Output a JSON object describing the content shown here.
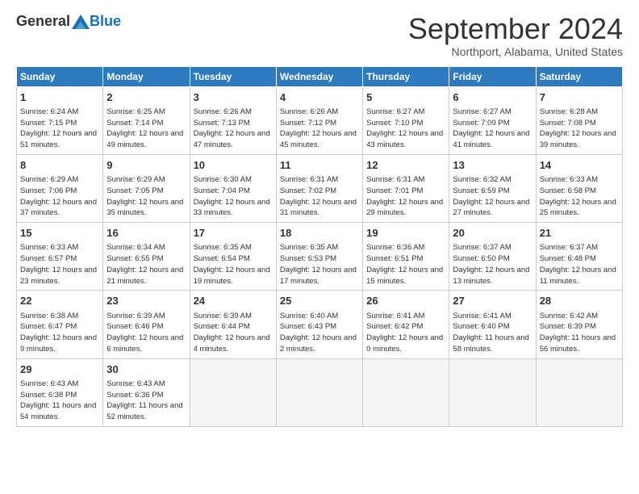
{
  "logo": {
    "general": "General",
    "blue": "Blue"
  },
  "title": "September 2024",
  "subtitle": "Northport, Alabama, United States",
  "days_of_week": [
    "Sunday",
    "Monday",
    "Tuesday",
    "Wednesday",
    "Thursday",
    "Friday",
    "Saturday"
  ],
  "weeks": [
    [
      {
        "day": "1",
        "info": "Sunrise: 6:24 AM\nSunset: 7:15 PM\nDaylight: 12 hours\nand 51 minutes."
      },
      {
        "day": "2",
        "info": "Sunrise: 6:25 AM\nSunset: 7:14 PM\nDaylight: 12 hours\nand 49 minutes."
      },
      {
        "day": "3",
        "info": "Sunrise: 6:26 AM\nSunset: 7:13 PM\nDaylight: 12 hours\nand 47 minutes."
      },
      {
        "day": "4",
        "info": "Sunrise: 6:26 AM\nSunset: 7:12 PM\nDaylight: 12 hours\nand 45 minutes."
      },
      {
        "day": "5",
        "info": "Sunrise: 6:27 AM\nSunset: 7:10 PM\nDaylight: 12 hours\nand 43 minutes."
      },
      {
        "day": "6",
        "info": "Sunrise: 6:27 AM\nSunset: 7:09 PM\nDaylight: 12 hours\nand 41 minutes."
      },
      {
        "day": "7",
        "info": "Sunrise: 6:28 AM\nSunset: 7:08 PM\nDaylight: 12 hours\nand 39 minutes."
      }
    ],
    [
      {
        "day": "8",
        "info": "Sunrise: 6:29 AM\nSunset: 7:06 PM\nDaylight: 12 hours\nand 37 minutes."
      },
      {
        "day": "9",
        "info": "Sunrise: 6:29 AM\nSunset: 7:05 PM\nDaylight: 12 hours\nand 35 minutes."
      },
      {
        "day": "10",
        "info": "Sunrise: 6:30 AM\nSunset: 7:04 PM\nDaylight: 12 hours\nand 33 minutes."
      },
      {
        "day": "11",
        "info": "Sunrise: 6:31 AM\nSunset: 7:02 PM\nDaylight: 12 hours\nand 31 minutes."
      },
      {
        "day": "12",
        "info": "Sunrise: 6:31 AM\nSunset: 7:01 PM\nDaylight: 12 hours\nand 29 minutes."
      },
      {
        "day": "13",
        "info": "Sunrise: 6:32 AM\nSunset: 6:59 PM\nDaylight: 12 hours\nand 27 minutes."
      },
      {
        "day": "14",
        "info": "Sunrise: 6:33 AM\nSunset: 6:58 PM\nDaylight: 12 hours\nand 25 minutes."
      }
    ],
    [
      {
        "day": "15",
        "info": "Sunrise: 6:33 AM\nSunset: 6:57 PM\nDaylight: 12 hours\nand 23 minutes."
      },
      {
        "day": "16",
        "info": "Sunrise: 6:34 AM\nSunset: 6:55 PM\nDaylight: 12 hours\nand 21 minutes."
      },
      {
        "day": "17",
        "info": "Sunrise: 6:35 AM\nSunset: 6:54 PM\nDaylight: 12 hours\nand 19 minutes."
      },
      {
        "day": "18",
        "info": "Sunrise: 6:35 AM\nSunset: 6:53 PM\nDaylight: 12 hours\nand 17 minutes."
      },
      {
        "day": "19",
        "info": "Sunrise: 6:36 AM\nSunset: 6:51 PM\nDaylight: 12 hours\nand 15 minutes."
      },
      {
        "day": "20",
        "info": "Sunrise: 6:37 AM\nSunset: 6:50 PM\nDaylight: 12 hours\nand 13 minutes."
      },
      {
        "day": "21",
        "info": "Sunrise: 6:37 AM\nSunset: 6:48 PM\nDaylight: 12 hours\nand 11 minutes."
      }
    ],
    [
      {
        "day": "22",
        "info": "Sunrise: 6:38 AM\nSunset: 6:47 PM\nDaylight: 12 hours\nand 9 minutes."
      },
      {
        "day": "23",
        "info": "Sunrise: 6:39 AM\nSunset: 6:46 PM\nDaylight: 12 hours\nand 6 minutes."
      },
      {
        "day": "24",
        "info": "Sunrise: 6:39 AM\nSunset: 6:44 PM\nDaylight: 12 hours\nand 4 minutes."
      },
      {
        "day": "25",
        "info": "Sunrise: 6:40 AM\nSunset: 6:43 PM\nDaylight: 12 hours\nand 2 minutes."
      },
      {
        "day": "26",
        "info": "Sunrise: 6:41 AM\nSunset: 6:42 PM\nDaylight: 12 hours\nand 0 minutes."
      },
      {
        "day": "27",
        "info": "Sunrise: 6:41 AM\nSunset: 6:40 PM\nDaylight: 11 hours\nand 58 minutes."
      },
      {
        "day": "28",
        "info": "Sunrise: 6:42 AM\nSunset: 6:39 PM\nDaylight: 11 hours\nand 56 minutes."
      }
    ],
    [
      {
        "day": "29",
        "info": "Sunrise: 6:43 AM\nSunset: 6:38 PM\nDaylight: 11 hours\nand 54 minutes."
      },
      {
        "day": "30",
        "info": "Sunrise: 6:43 AM\nSunset: 6:36 PM\nDaylight: 11 hours\nand 52 minutes."
      },
      {
        "day": "",
        "info": ""
      },
      {
        "day": "",
        "info": ""
      },
      {
        "day": "",
        "info": ""
      },
      {
        "day": "",
        "info": ""
      },
      {
        "day": "",
        "info": ""
      }
    ]
  ]
}
